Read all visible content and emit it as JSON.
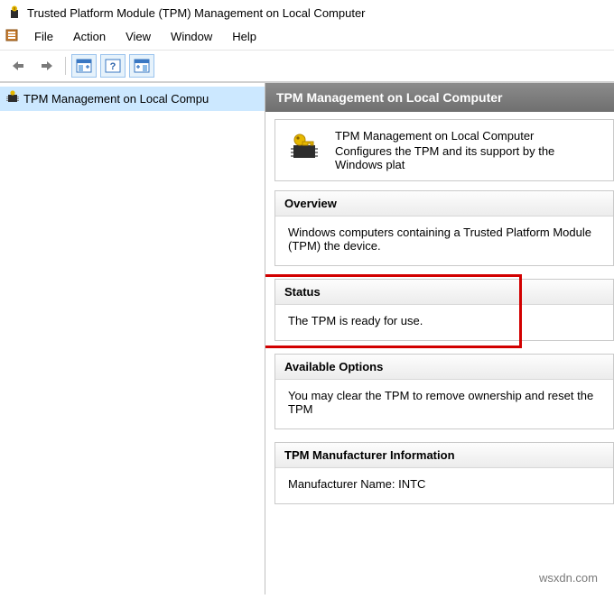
{
  "window": {
    "title": "Trusted Platform Module (TPM) Management on Local Computer"
  },
  "menu": {
    "file": "File",
    "action": "Action",
    "view": "View",
    "window": "Window",
    "help": "Help"
  },
  "tree": {
    "item1": "TPM Management on Local Compu"
  },
  "detail": {
    "header": "TPM Management on Local Computer",
    "intro_title": "TPM Management on Local Computer",
    "intro_desc": "Configures the TPM and its support by the Windows plat",
    "overview_label": "Overview",
    "overview_text": "Windows computers containing a Trusted Platform Module (TPM) the device.",
    "status_label": "Status",
    "status_text": "The TPM is ready for use.",
    "options_label": "Available Options",
    "options_text": "You may clear the TPM to remove ownership and reset the TPM",
    "mfr_label": "TPM Manufacturer Information",
    "mfr_text": "Manufacturer Name:  INTC"
  },
  "watermark": "wsxdn.com"
}
